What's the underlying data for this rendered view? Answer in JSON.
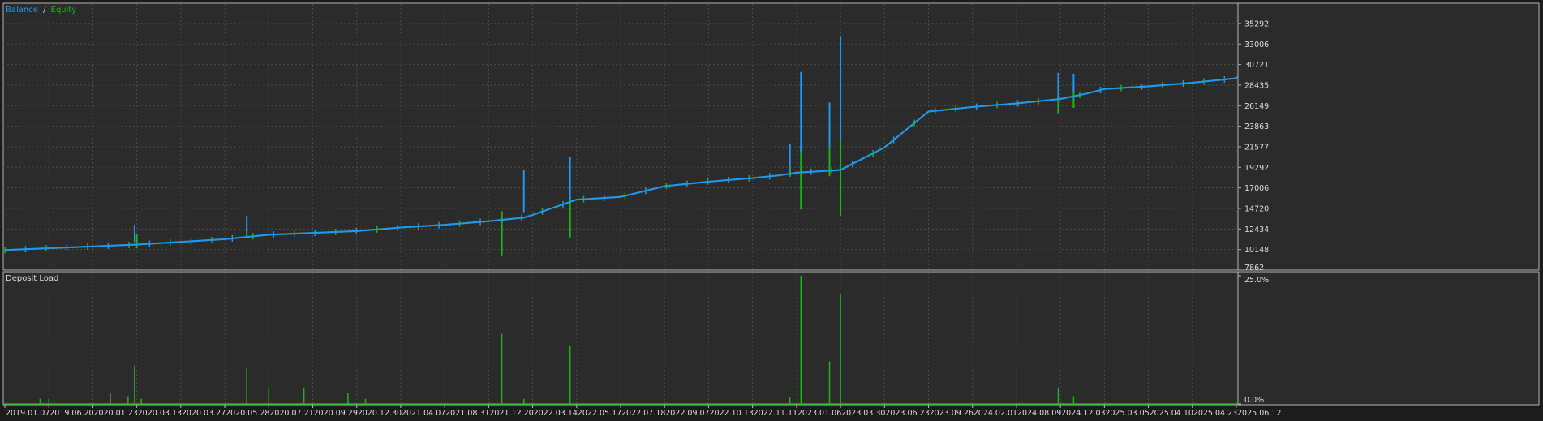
{
  "colors": {
    "background": "#2b2b2b",
    "outer": "#1c1c1c",
    "frame": "#b5b5b5",
    "grid": "#4a4a4a",
    "text": "#dcdcdc",
    "balance": "#2196f3",
    "equity": "#1fb31f",
    "deposit_load": "#1fb31f"
  },
  "legend": {
    "balance_label": "Balance",
    "separator": "/",
    "equity_label": "Equity"
  },
  "chart_data": [
    {
      "type": "line",
      "ylim": [
        7862,
        37000
      ],
      "y_ticks": [
        7862,
        10148,
        12434,
        14720,
        17006,
        19292,
        21577,
        23863,
        26149,
        28435,
        30721,
        33006,
        35292
      ],
      "x_ticks": [
        "2019.01.07",
        "2019.06.20",
        "2020.01.23",
        "2020.03.13",
        "2020.03.27",
        "2020.05.28",
        "2020.07.21",
        "2020.09.29",
        "2020.12.30",
        "2021.04.07",
        "2021.08.31",
        "2021.12.20",
        "2022.03.14",
        "2022.05.17",
        "2022.07.18",
        "2022.09.07",
        "2022.10.13",
        "2022.11.11",
        "2023.01.06",
        "2023.03.30",
        "2023.06.23",
        "2023.09.26",
        "2024.02.01",
        "2024.08.09",
        "2024.12.03",
        "2025.03.05",
        "2025.04.10",
        "2025.04.23",
        "2025.06.12"
      ],
      "grid": true,
      "series": [
        {
          "name": "Balance",
          "x": [
            0,
            3,
            5,
            6,
            7,
            8,
            9,
            10,
            11,
            11.8,
            12,
            13,
            14,
            15,
            16,
            17,
            17.6,
            18,
            19,
            20,
            21,
            22,
            23,
            24,
            24.6,
            25,
            26,
            27,
            28
          ],
          "values": [
            10100,
            10700,
            11300,
            11800,
            12000,
            12200,
            12600,
            12900,
            13300,
            13700,
            14000,
            15700,
            16000,
            17200,
            17700,
            18100,
            18400,
            18700,
            19000,
            21500,
            25500,
            26000,
            26400,
            26900,
            27500,
            28000,
            28300,
            28700,
            29200
          ]
        },
        {
          "name": "Equity",
          "x": [
            0,
            3,
            5,
            6,
            7,
            8,
            9,
            10,
            11,
            11.8,
            12,
            13,
            14,
            15,
            16,
            17,
            17.6,
            18,
            19,
            20,
            21,
            22,
            23,
            24,
            24.6,
            25,
            26,
            27,
            28
          ],
          "values": [
            10100,
            10700,
            11300,
            11800,
            12000,
            12200,
            12600,
            12900,
            13300,
            13700,
            14000,
            15700,
            16000,
            17200,
            17700,
            18100,
            18400,
            18700,
            19000,
            21500,
            25500,
            26000,
            26400,
            26900,
            27500,
            28000,
            28300,
            28700,
            29200
          ]
        }
      ],
      "balance_spikes": [
        {
          "x": 2.95,
          "from": 11000,
          "to": 12900
        },
        {
          "x": 5.5,
          "from": 12200,
          "to": 13900
        },
        {
          "x": 11.8,
          "from": 14300,
          "to": 19000
        },
        {
          "x": 12.85,
          "from": 15800,
          "to": 20500
        },
        {
          "x": 17.85,
          "from": 18400,
          "to": 21900
        },
        {
          "x": 18.1,
          "from": 21000,
          "to": 29900
        },
        {
          "x": 18.75,
          "from": 21600,
          "to": 26500
        },
        {
          "x": 19.0,
          "from": 22300,
          "to": 33900
        },
        {
          "x": 23.95,
          "from": 27000,
          "to": 29800
        },
        {
          "x": 24.3,
          "from": 27700,
          "to": 29700
        }
      ],
      "equity_spikes": [
        {
          "x": 3.0,
          "from": 10300,
          "to": 11900
        },
        {
          "x": 5.5,
          "from": 11400,
          "to": 12500
        },
        {
          "x": 11.3,
          "from": 9500,
          "to": 14400
        },
        {
          "x": 12.85,
          "from": 11500,
          "to": 16000
        },
        {
          "x": 18.1,
          "from": 14600,
          "to": 21700
        },
        {
          "x": 18.75,
          "from": 18300,
          "to": 22800
        },
        {
          "x": 19.0,
          "from": 13900,
          "to": 25500
        },
        {
          "x": 23.95,
          "from": 25300,
          "to": 27400
        },
        {
          "x": 24.3,
          "from": 25900,
          "to": 28200
        }
      ]
    },
    {
      "type": "bar",
      "title": "Deposit Load",
      "ylim": [
        0,
        25.0
      ],
      "y_ticks": [
        "25.0%",
        "0.0%"
      ],
      "x": [
        0.8,
        1.0,
        2.4,
        2.8,
        2.95,
        3.1,
        5.5,
        6.0,
        6.8,
        7.8,
        8.2,
        11.3,
        11.8,
        12.85,
        17.85,
        18.1,
        18.75,
        19.0,
        23.95,
        24.3
      ],
      "values": [
        1,
        1,
        2,
        1.5,
        7.5,
        1,
        7,
        3.2,
        3.2,
        2.2,
        1,
        13.7,
        1,
        11.3,
        1.3,
        25.0,
        8.3,
        21.5,
        3.2,
        1.5
      ]
    }
  ]
}
